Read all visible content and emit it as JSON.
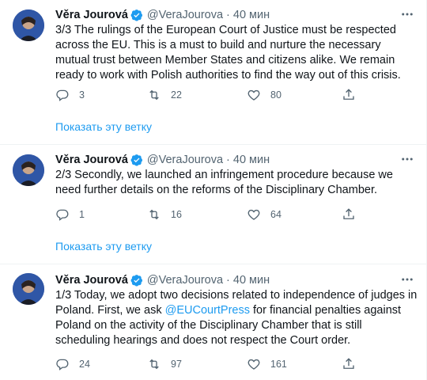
{
  "tweets": [
    {
      "author": {
        "name": "Věra Jourová",
        "handle": "@VeraJourova",
        "time": "40 мин"
      },
      "text": "3/3 The rulings of the European Court of Justice must be respected across the EU. This is a must to build and nurture the necessary mutual trust between Member States and citizens alike. We remain ready to work with Polish authorities to find the way out of this crisis.",
      "stats": {
        "replies": "3",
        "retweets": "22",
        "likes": "80"
      },
      "thread_link": "Показать эту ветку"
    },
    {
      "author": {
        "name": "Věra Jourová",
        "handle": "@VeraJourova",
        "time": "40 мин"
      },
      "text": "2/3 Secondly, we launched an infringement procedure because we need further details on the reforms of the Disciplinary Chamber.",
      "stats": {
        "replies": "1",
        "retweets": "16",
        "likes": "64"
      },
      "thread_link": "Показать эту ветку"
    },
    {
      "author": {
        "name": "Věra Jourová",
        "handle": "@VeraJourova",
        "time": "40 мин"
      },
      "text_before": "1/3 Today, we adopt two decisions related to independence of judges in Poland. First, we ask ",
      "mention": "@EUCourtPress",
      "text_after": " for financial penalties against Poland on the activity of the Disciplinary Chamber that is still scheduling hearings and does not respect the Court order.",
      "stats": {
        "replies": "24",
        "retweets": "97",
        "likes": "161"
      }
    }
  ],
  "separator": "·",
  "colors": {
    "accent": "#1d9bf0",
    "secondary_text": "#536471",
    "border": "#eff3f4",
    "primary_text": "#0f1419"
  },
  "icons": [
    "reply-icon",
    "retweet-icon",
    "like-icon",
    "share-icon",
    "more-icon",
    "verified-badge-icon"
  ]
}
